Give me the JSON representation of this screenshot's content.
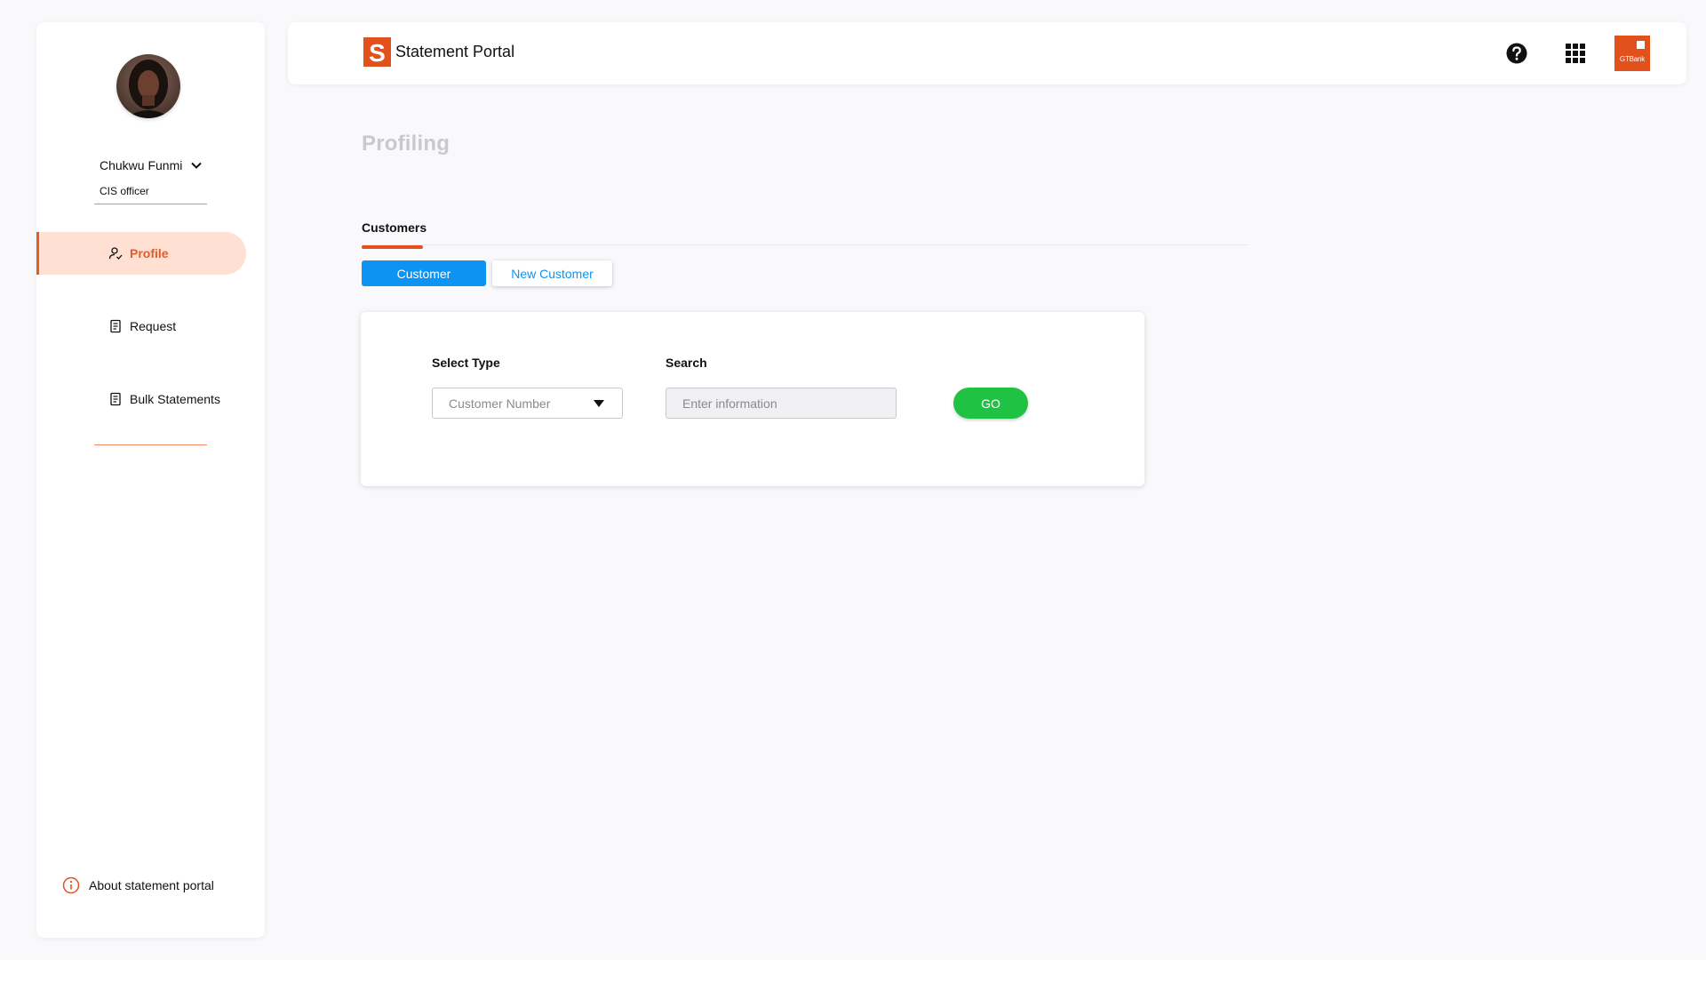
{
  "app": {
    "title": "Statement Portal",
    "brand_logo_letter": "S",
    "bank_logo_text": "GTBank"
  },
  "user": {
    "name": "Chukwu Funmi",
    "role": "CIS officer"
  },
  "sidebar": {
    "items": [
      {
        "label": "Profile",
        "icon": "user-icon",
        "active": true
      },
      {
        "label": "Request",
        "icon": "document-icon",
        "active": false
      },
      {
        "label": "Bulk Statements",
        "icon": "document-icon",
        "active": false
      }
    ],
    "about_label": "About statement portal"
  },
  "header": {
    "icons": [
      "help-icon",
      "apps-grid-icon",
      "gtbank-logo"
    ]
  },
  "main": {
    "page_title": "Profiling",
    "section_tab": "Customers",
    "segments": [
      {
        "label": "Customer",
        "selected": true
      },
      {
        "label": "New Customer",
        "selected": false
      }
    ],
    "form": {
      "select_type_label": "Select Type",
      "select_type_value": "Customer Number",
      "search_label": "Search",
      "search_placeholder": "Enter information",
      "search_value": "",
      "go_label": "GO"
    }
  },
  "colors": {
    "accent": "#e2501c",
    "accent_light": "#ffe0d3",
    "primary_blue": "#0d93f2",
    "go_green": "#20c243"
  }
}
